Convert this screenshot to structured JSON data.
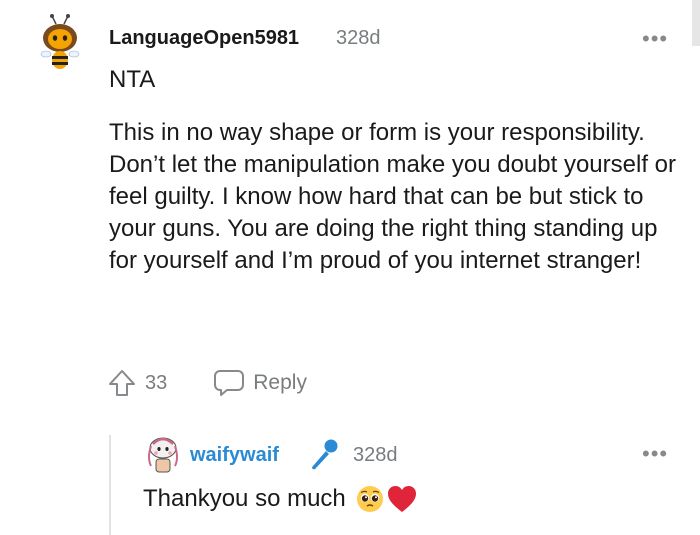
{
  "comment": {
    "username": "LanguageOpen5981",
    "age": "328d",
    "paragraphs": [
      "NTA",
      "This in no way shape or form is your responsibility. Don’t let the manipulation make you doubt yourself or feel guilty. I know how hard that can be but stick to your guns. You are doing the right thing standing up for yourself and I’m proud of you internet stranger!"
    ],
    "upvote_count": "33",
    "reply_label": "Reply",
    "more_label": "•••"
  },
  "reply": {
    "username": "waifywaif",
    "flair_icon": "microphone-icon",
    "age": "328d",
    "text": "Thankyou so much",
    "emojis": [
      "pleading-face-icon",
      "red-heart-icon"
    ],
    "more_label": "•••"
  },
  "colors": {
    "reply_username": "#2a8bd4",
    "meta_gray": "#787c7e",
    "heart_red": "#e0243a"
  }
}
